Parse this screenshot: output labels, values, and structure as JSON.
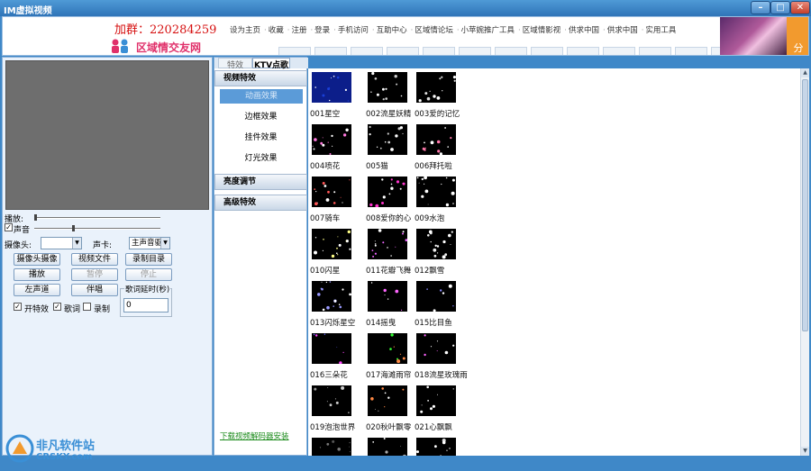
{
  "window": {
    "title": "IM虚拟视频"
  },
  "banner": {
    "group_label": "加群：",
    "group_number": "220284259",
    "nav_links": [
      "设为主页",
      "收藏",
      "注册",
      "登录",
      "手机访问",
      "互助中心",
      "区域情论坛",
      "小苹婉推广工具",
      "区域情影视",
      "供求中国",
      "供求中国",
      "实用工具"
    ],
    "logo_text": "区域情交友网",
    "share_label": "分"
  },
  "left_panel": {
    "play_label": "播放:",
    "volume_label": "声音",
    "volume_checked": true,
    "camera_label": "摄像头:",
    "camera_value": "",
    "soundcard_label": "声卡:",
    "soundcard_value": "主声音驱",
    "buttons": {
      "camera_capture": "摄像头摄像",
      "video_file": "视频文件",
      "record_dir": "录制目录",
      "play": "播放",
      "pause": "暂停",
      "stop": "停止",
      "left_channel": "左声道",
      "accompany": "伴唱"
    },
    "delay_label": "歌词延时(秒)",
    "delay_value": "0",
    "enable_effects_label": "开特效",
    "enable_effects_checked": true,
    "lyrics_label": "歌词",
    "lyrics_checked": true,
    "record_label": "录制",
    "record_checked": false
  },
  "mid_panel": {
    "tabs": [
      "特效",
      "KTV点歌"
    ],
    "categories": [
      {
        "label": "视频特效",
        "items": [
          "动画效果",
          "边框效果",
          "挂件效果",
          "灯光效果"
        ],
        "selected": "动画效果"
      },
      {
        "label": "亮度调节"
      },
      {
        "label": "高级特效"
      }
    ],
    "download_link": "下载视频解码器安装"
  },
  "effects": [
    "001星空",
    "002流星妖精",
    "003爱的记忆",
    "004喷花",
    "005猫",
    "006拜托啦",
    "007骑车",
    "008爱你的心",
    "009水泡",
    "010闪星",
    "011花瓣飞舞",
    "012飘雪",
    "013闪烁星空",
    "014摇曳",
    "015比目鱼",
    "016三朵花",
    "017海滩雨帘",
    "018流星玫瑰雨",
    "019泡泡世界",
    "020秋叶飘零",
    "021心飘飘",
    "",
    "",
    ""
  ],
  "watermark": {
    "name": "非凡软件站",
    "url": "CRSKY.com"
  }
}
